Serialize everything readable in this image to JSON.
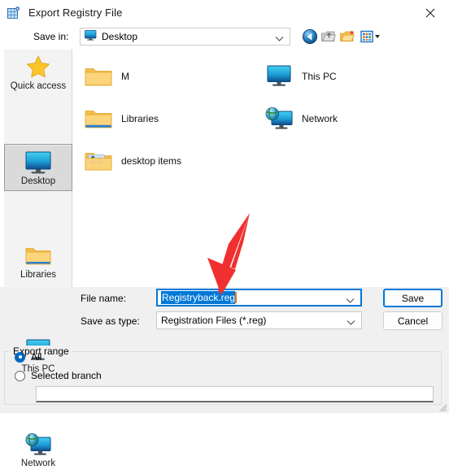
{
  "window": {
    "title": "Export Registry File",
    "icon": "registry-editor-icon",
    "close_label": "✕"
  },
  "toolbar": {
    "save_in_label": "Save in:",
    "save_in_value": "Desktop",
    "buttons": [
      {
        "name": "back-button",
        "tooltip": "Back"
      },
      {
        "name": "up-one-level-button",
        "tooltip": "Up one level"
      },
      {
        "name": "new-folder-button",
        "tooltip": "Create New Folder"
      },
      {
        "name": "views-button",
        "tooltip": "Views"
      }
    ]
  },
  "places_bar": {
    "items": [
      {
        "label": "Quick access",
        "icon": "star-icon",
        "selected": false
      },
      {
        "label": "Desktop",
        "icon": "monitor-icon",
        "selected": true
      },
      {
        "label": "Libraries",
        "icon": "folder-icon",
        "selected": false
      },
      {
        "label": "This PC",
        "icon": "monitor-icon",
        "selected": false
      },
      {
        "label": "Network",
        "icon": "network-globe-icon",
        "selected": false
      }
    ]
  },
  "file_list": {
    "items": [
      {
        "label": "M",
        "icon": "folder-icon"
      },
      {
        "label": "This PC",
        "icon": "monitor-icon"
      },
      {
        "label": "Libraries",
        "icon": "libraries-folder-icon"
      },
      {
        "label": "Network",
        "icon": "network-globe-icon"
      },
      {
        "label": "desktop items",
        "icon": "desktop-items-folder-icon"
      }
    ]
  },
  "form": {
    "file_name_label": "File name:",
    "file_name_value": "Registryback.reg",
    "file_name_selected": true,
    "save_as_type_label": "Save as type:",
    "save_as_type_value": "Registration Files (*.reg)",
    "save_button": "Save",
    "cancel_button": "Cancel"
  },
  "export_range": {
    "legend": "Export range",
    "options": [
      {
        "label": "All",
        "checked": true
      },
      {
        "label": "Selected branch",
        "checked": false
      }
    ],
    "branch_value": ""
  },
  "annotation": {
    "type": "red-arrow",
    "color": "#f03030",
    "points_to": "file-name-input"
  },
  "colors": {
    "accent": "#0078d7",
    "radio_accent": "#0067c0",
    "window_bg": "#f0f0f0",
    "panel_bg": "#ffffff",
    "places_bg": "#f3f3f3",
    "selection_bg": "#0078d7",
    "caret": "#e07b1f",
    "annotation": "#f03030"
  }
}
